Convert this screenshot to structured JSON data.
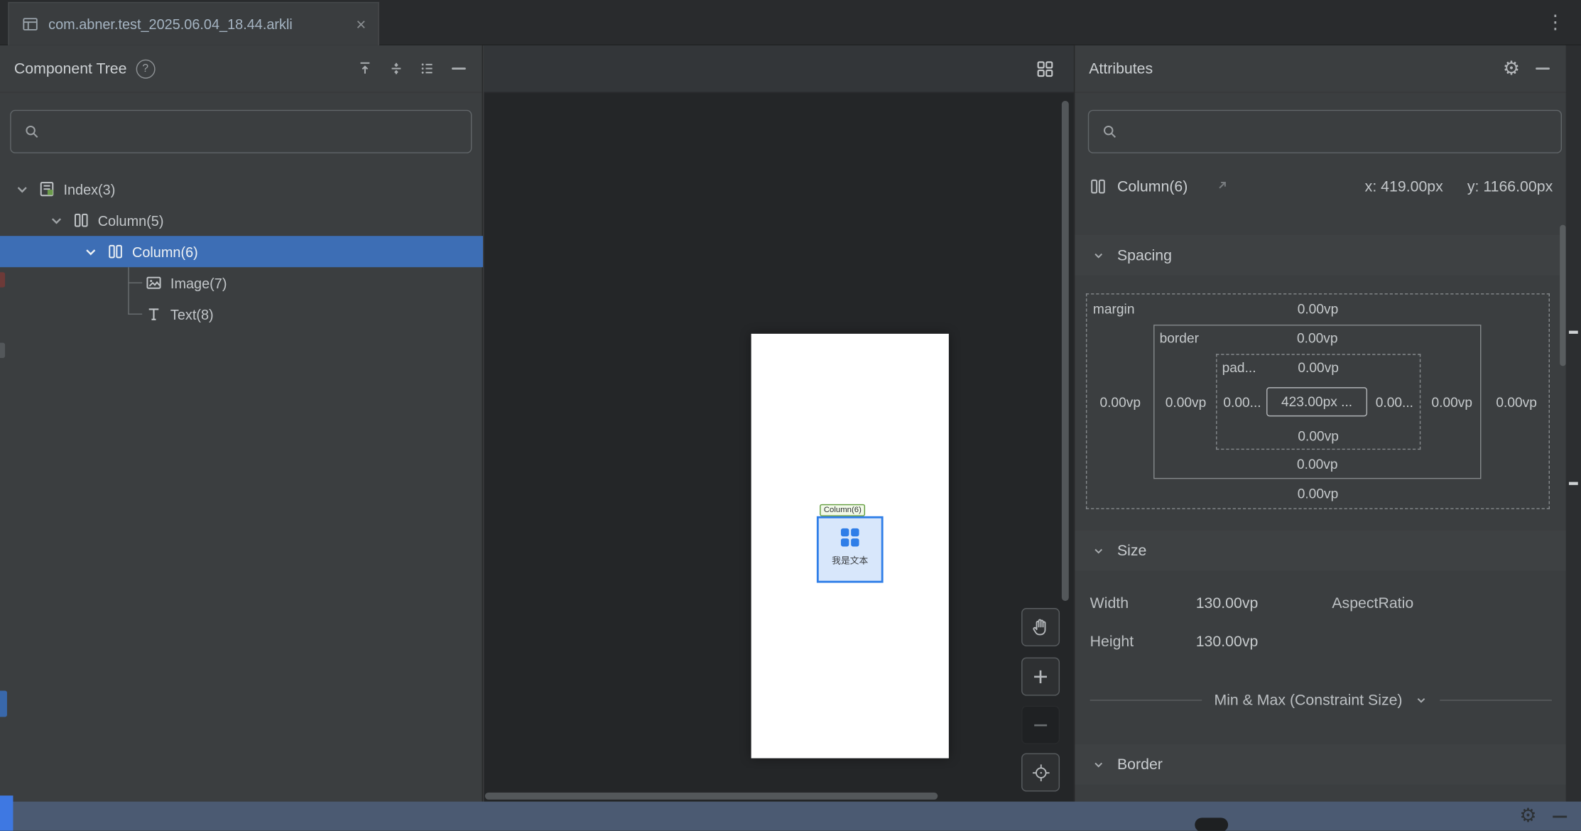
{
  "window": {
    "tab_title": "com.abner.test_2025.06.04_18.44.arkli",
    "tab_close": "×",
    "more_icon": "⋮",
    "gear_icon": "⚙"
  },
  "component_tree": {
    "title": "Component Tree",
    "help_icon": "?",
    "nodes": [
      {
        "label": "Index(3)"
      },
      {
        "label": "Column(5)"
      },
      {
        "label": "Column(6)"
      },
      {
        "label": "Image(7)"
      },
      {
        "label": "Text(8)"
      }
    ]
  },
  "canvas": {
    "selection_tag": "Column(6)",
    "preview_text": "我是文本",
    "zoom_in_label": "+",
    "zoom_out_label": "−"
  },
  "attributes": {
    "title": "Attributes",
    "component": {
      "name": "Column(6)",
      "x_label": "x: 419.00px",
      "y_label": "y: 1166.00px"
    },
    "spacing": {
      "title": "Spacing",
      "margin_label": "margin",
      "border_label": "border",
      "padding_label": "pad...",
      "margin_top": "0.00vp",
      "margin_left": "0.00vp",
      "margin_right": "0.00vp",
      "margin_bottom": "0.00vp",
      "border_top": "0.00vp",
      "border_left": "0.00vp",
      "border_right": "0.00vp",
      "border_bottom": "0.00vp",
      "padding_top": "0.00vp",
      "padding_left": "0.00...",
      "padding_right": "0.00...",
      "padding_bottom": "0.00vp",
      "content": "423.00px ..."
    },
    "size": {
      "title": "Size",
      "width_label": "Width",
      "width_value": "130.00vp",
      "aspect_ratio_label": "AspectRatio",
      "height_label": "Height",
      "height_value": "130.00vp",
      "minmax_label": "Min & Max (Constraint Size)"
    },
    "border_section": {
      "title": "Border"
    }
  }
}
